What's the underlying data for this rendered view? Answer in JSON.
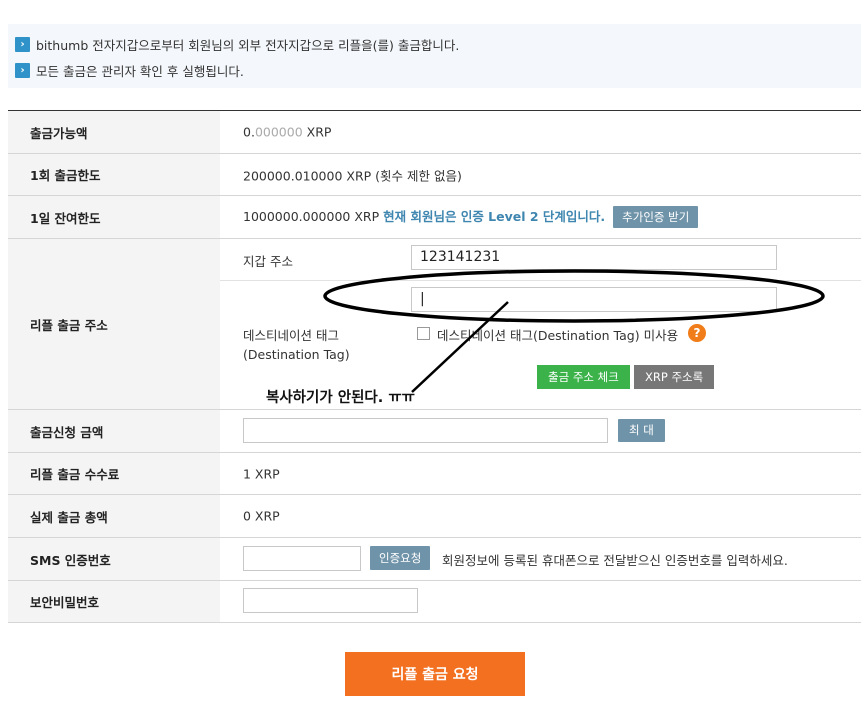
{
  "notice": {
    "line1": "bithumb 전자지갑으로부터 회원님의 외부 전자지갑으로 리플을(를) 출금합니다.",
    "line2": "모든 출금은 관리자 확인 후 실행됩니다."
  },
  "rows": {
    "available": {
      "label": "출금가능액",
      "value_main": "0.",
      "value_grey": "000000",
      "value_unit": " XRP"
    },
    "per_limit": {
      "label": "1회 출금한도",
      "value": "200000.010000 XRP (횟수 제한 없음)"
    },
    "daily_limit": {
      "label": "1일 잔여한도",
      "value": "1000000.000000 XRP",
      "level_text": "현재 회원님은 인증 Level 2 단계입니다.",
      "button": "추가인증 받기"
    },
    "address": {
      "label": "리플 출금 주소",
      "wallet_label": "지갑 주소",
      "wallet_value": "123141231",
      "dest_tag_value": "|",
      "dest_tag_label_1": "데스티네이션 태그",
      "dest_tag_label_2": "(Destination Tag)",
      "checkbox_label": "데스티네이션 태그(Destination Tag) 미사용",
      "help": "?",
      "check_button": "출금 주소 체크",
      "book_button": "XRP 주소록"
    },
    "amount": {
      "label": "출금신청 금액",
      "max_button": "최 대"
    },
    "fee": {
      "label": "리플 출금 수수료",
      "value": "1 XRP"
    },
    "total": {
      "label": "실제 출금 총액",
      "value": "0 XRP"
    },
    "sms": {
      "label": "SMS 인증번호",
      "button": "인증요청",
      "hint": "회원정보에 등록된 휴대폰으로 전달받으신 인증번호를 입력하세요."
    },
    "password": {
      "label": "보안비밀번호"
    }
  },
  "annotation": "복사하기가 안된다. ㅠㅠ",
  "submit_label": "리플 출금 요청",
  "colors": {
    "accent_orange": "#f37021",
    "green": "#3bb34a",
    "steel": "#6f93a8",
    "notice_icon": "#2f93c9"
  }
}
